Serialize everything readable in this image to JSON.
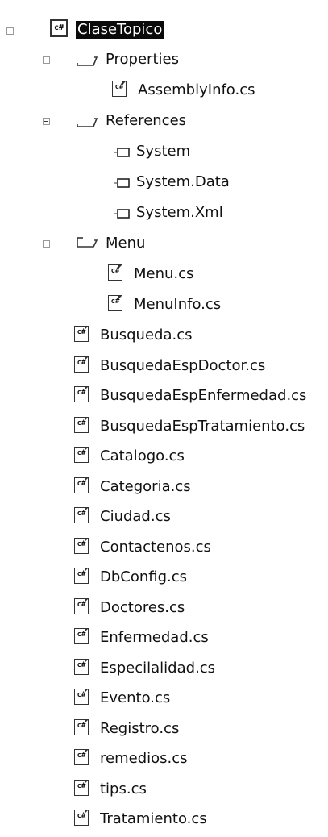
{
  "tree": {
    "project": {
      "label": "ClaseTopico",
      "icon": "csharp-project-icon"
    },
    "properties": {
      "label": "Properties",
      "icon": "folder-open-icon",
      "children": [
        "AssemblyInfo.cs"
      ]
    },
    "references": {
      "label": "References",
      "icon": "folder-open-icon",
      "children": [
        "System",
        "System.Data",
        "System.Xml"
      ]
    },
    "menu": {
      "label": "Menu",
      "icon": "folder-open-icon",
      "children": [
        "Menu.cs",
        "MenuInfo.cs"
      ]
    },
    "files": [
      "Busqueda.cs",
      "BusquedaEspDoctor.cs",
      "BusquedaEspEnfermedad.cs",
      "BusquedaEspTratamiento.cs",
      "Catalogo.cs",
      "Categoria.cs",
      "Ciudad.cs",
      "Contactenos.cs",
      "DbConfig.cs",
      "Doctores.cs",
      "Enfermedad.cs",
      "Especilalidad.cs",
      "Evento.cs",
      "Registro.cs",
      "remedios.cs",
      "tips.cs",
      "Tratamiento.cs"
    ]
  },
  "icon_text": {
    "csharp": "c#"
  }
}
